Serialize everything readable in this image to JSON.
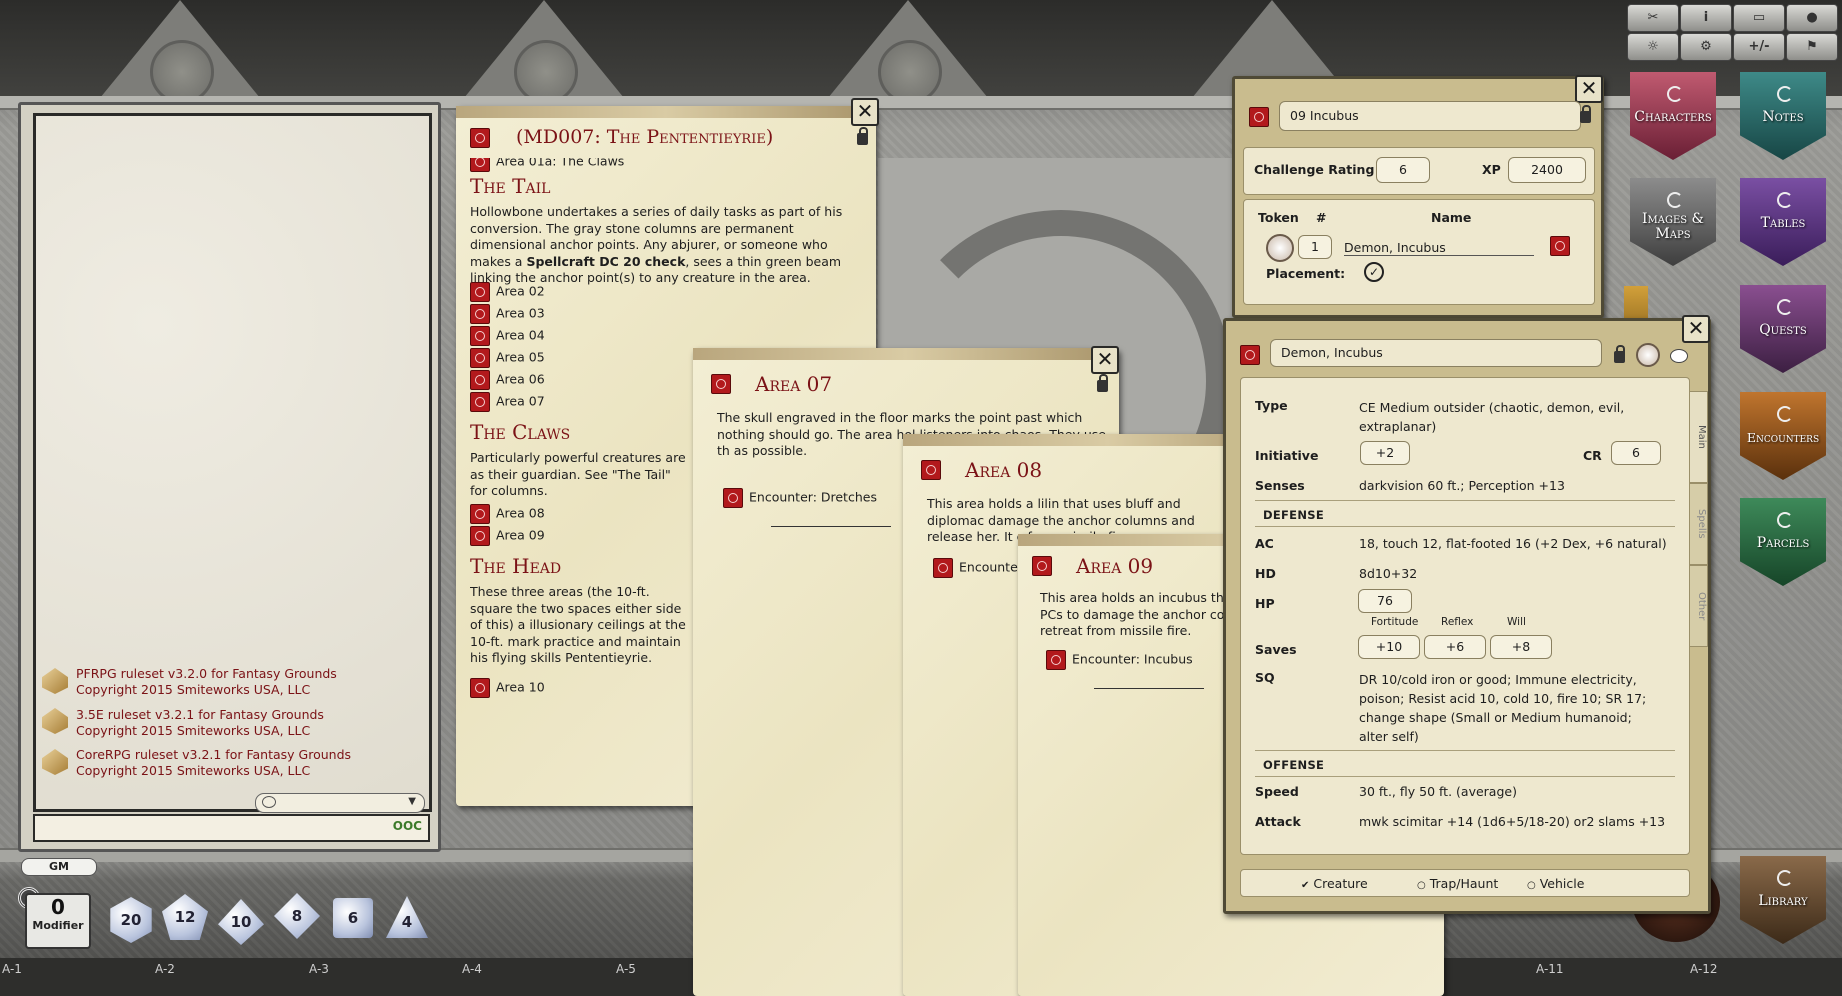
{
  "grid": [
    "A-1",
    "A-2",
    "A-3",
    "A-4",
    "A-5",
    "A-11",
    "A-12"
  ],
  "topbar": [
    "✂",
    "i",
    "▭",
    "●",
    "☼",
    "⚙",
    "+/-",
    "⚑"
  ],
  "sidebar": {
    "characters": "Characters",
    "notes": "Notes",
    "images": "Images & Maps",
    "tables": "Tables",
    "quests": "Quests",
    "encounters": "Encounters",
    "parcels": "Parcels",
    "library": "Library"
  },
  "chat": {
    "lines": [
      {
        "title": "PFRPG ruleset v3.2.0 for Fantasy Grounds",
        "copy": "Copyright 2015 Smiteworks USA, LLC"
      },
      {
        "title": "3.5E ruleset v3.2.1 for Fantasy Grounds",
        "copy": "Copyright 2015 Smiteworks USA, LLC"
      },
      {
        "title": "CoreRPG ruleset v3.2.1 for Fantasy Grounds",
        "copy": "Copyright 2015 Smiteworks USA, LLC"
      }
    ],
    "ooc": "OOC",
    "gm": "GM",
    "modifier_value": "0",
    "modifier_label": "Modifier"
  },
  "dice": [
    "20",
    "12",
    "10",
    "8",
    "6",
    "4"
  ],
  "story": {
    "title": "(MD007: The Pententieyrie)",
    "first_link": "Area 01a: The Claws",
    "tail_head": "The Tail",
    "tail_body_1": "Hollowbone undertakes a series of daily tasks as part of his conversion. The gray stone columns are permanent dimensional anchor points. Any abjurer, or someone who makes a",
    "tail_bold": "Spellcraft DC 20 check",
    "tail_body_2": ", sees a thin green beam linking the anchor point(s) to any creature in the area.",
    "tail_links": [
      "Area 02",
      "Area 03",
      "Area 04",
      "Area 05",
      "Area 06",
      "Area 07"
    ],
    "claws_head": "The Claws",
    "claws_body": "Particularly powerful creatures are as their guardian. See \"The Tail\" for columns.",
    "claws_links": [
      "Area 08",
      "Area 09"
    ],
    "head_head": "The Head",
    "head_body": "These three areas (the 10-ft. square the two spaces either side of this) a illusionary ceilings at the 10-ft. mark practice and maintain his flying skills Pententieyrie.",
    "head_links": [
      "Area 10"
    ]
  },
  "area07": {
    "title": "Area 07",
    "body": "The skull engraved in the floor marks the point past which nothing should go. The area hol listeners into chaos. They use th as possible.",
    "link": "Encounter: Dretches"
  },
  "area08": {
    "title": "Area 08",
    "body": "This area holds a lilin that uses bluff and diplomac damage the anchor columns and release her. It c from missile fir",
    "link": "Encounte"
  },
  "area09": {
    "title": "Area 09",
    "body": "This area holds an incubus that PCs to damage the anchor colu retreat from missile fire.",
    "link": "Encounter: Incubus"
  },
  "encounter": {
    "name": "09 Incubus",
    "cr_label": "Challenge Rating",
    "cr": "6",
    "xp_label": "XP",
    "xp": "2400",
    "token_label": "Token",
    "num_label": "#",
    "name_label": "Name",
    "count": "1",
    "creature": "Demon, Incubus",
    "placement_label": "Placement:"
  },
  "npc": {
    "name": "Demon, Incubus",
    "tabs": [
      "Main",
      "Spells",
      "Other"
    ],
    "type_label": "Type",
    "type": "CE Medium outsider (chaotic, demon, evil, extraplanar)",
    "init_label": "Initiative",
    "init": "+2",
    "cr_label": "CR",
    "cr": "6",
    "senses_label": "Senses",
    "senses": "darkvision 60 ft.; Perception +13",
    "defense_head": "DEFENSE",
    "ac_label": "AC",
    "ac": "18, touch 12, flat-footed 16 (+2 Dex, +6 natural)",
    "hd_label": "HD",
    "hd": "8d10+32",
    "hp_label": "HP",
    "hp": "76",
    "saves_label": "Saves",
    "fort_label": "Fortitude",
    "fort": "+10",
    "ref_label": "Reflex",
    "ref": "+6",
    "will_label": "Will",
    "will": "+8",
    "sq_label": "SQ",
    "sq": "DR 10/cold iron or good; Immune electricity, poison; Resist acid 10, cold 10, fire 10; SR 17; change shape (Small or Medium humanoid; alter self)",
    "offense_head": "OFFENSE",
    "speed_label": "Speed",
    "speed": "30 ft., fly 50 ft. (average)",
    "attack_label": "Attack",
    "attack": "mwk scimitar +14 (1d6+5/18-20) or2 slams +13",
    "types": [
      "Creature",
      "Trap/Haunt",
      "Vehicle"
    ]
  }
}
